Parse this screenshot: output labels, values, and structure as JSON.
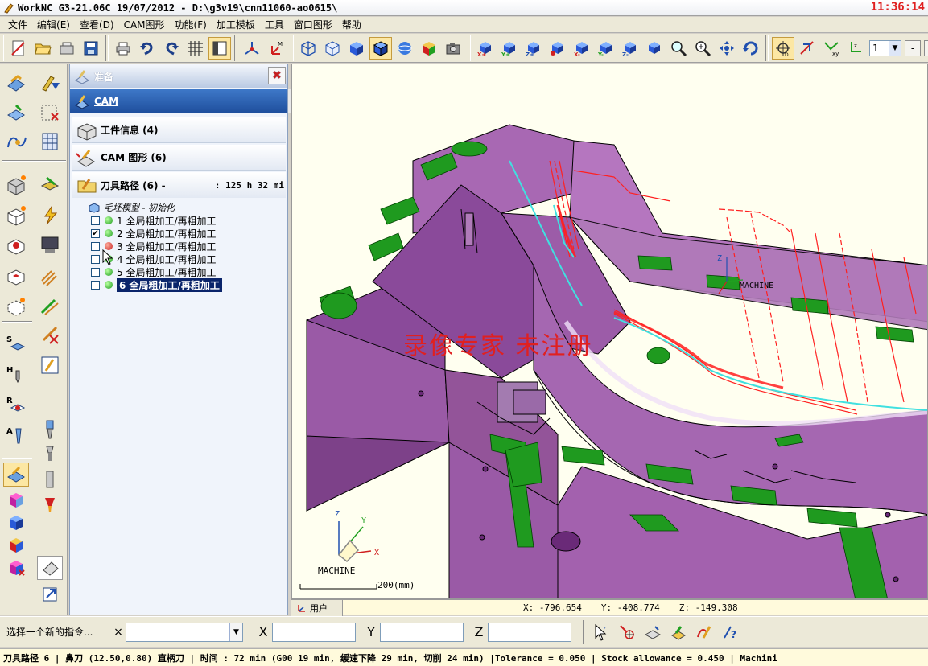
{
  "window": {
    "title": "WorkNC G3-21.06C  19/07/2012 - D:\\g3v19\\cnn11060-ao0615\\",
    "clock": "11:36:14"
  },
  "menu": [
    "文件",
    "编辑(E)",
    "查看(D)",
    "CAM图形",
    "功能(F)",
    "加工模板",
    "工具",
    "窗口图形",
    "帮助"
  ],
  "toolbar": {
    "zoom_select_value": "1",
    "minus_label": "-",
    "plus_label": "+"
  },
  "panel": {
    "prep_label": "准备",
    "cam_label": "CAM",
    "close_symbol": "✖",
    "check_symbol": "✔",
    "workpiece_info": "工件信息  (4)",
    "cam_graphics": "CAM 图形  (6)",
    "toolpaths_title": "刀具路径  (6) -",
    "toolpaths_time": ": 125 h 32 mi",
    "stock_model": "毛坯模型 - 初始化",
    "toolpaths": [
      {
        "num": "1",
        "label": "全局粗加工/再粗加工",
        "checked": false,
        "status": "green"
      },
      {
        "num": "2",
        "label": "全局粗加工/再粗加工",
        "checked": true,
        "status": "green"
      },
      {
        "num": "3",
        "label": "全局粗加工/再粗加工",
        "checked": false,
        "status": "red"
      },
      {
        "num": "4",
        "label": "全局粗加工/再粗加工",
        "checked": false,
        "status": "green"
      },
      {
        "num": "5",
        "label": "全局粗加工/再粗加工",
        "checked": false,
        "status": "green"
      },
      {
        "num": "6",
        "label": "全局粗加工/再粗加工",
        "checked": false,
        "status": "green"
      }
    ]
  },
  "viewport": {
    "watermark": "录像专家  未注册",
    "machine_label": "MACHINE",
    "machine_label_small": "MACHINE",
    "scale_label": "200(mm)",
    "axis_x": "X",
    "axis_y": "Y",
    "axis_z": "Z"
  },
  "coordbar": {
    "user_tab": "用户",
    "x": "X: -796.654",
    "y": "Y: -408.774",
    "z": "Z: -149.308"
  },
  "cmdbar": {
    "prompt": "选择一个新的指令...",
    "close_symbol": "×",
    "x_label": "X",
    "y_label": "Y",
    "z_label": "Z"
  },
  "status": {
    "text": "刀具路径 6 | 鼻刀 (12.50,0.80) 直柄刀 | 时间 : 72 min (G00 19 min, 缓速下降 29 min, 切削 24 min) |Tolerance = 0.050 | Stock allowance = 0.450 | Machini"
  },
  "colors": {
    "part_face": "#9a5aa6",
    "pads": "#1f9a1f",
    "toolpath_red": "#ff2020",
    "toolpath_cyan": "#40e0e0",
    "highlight": "#0a246a"
  }
}
